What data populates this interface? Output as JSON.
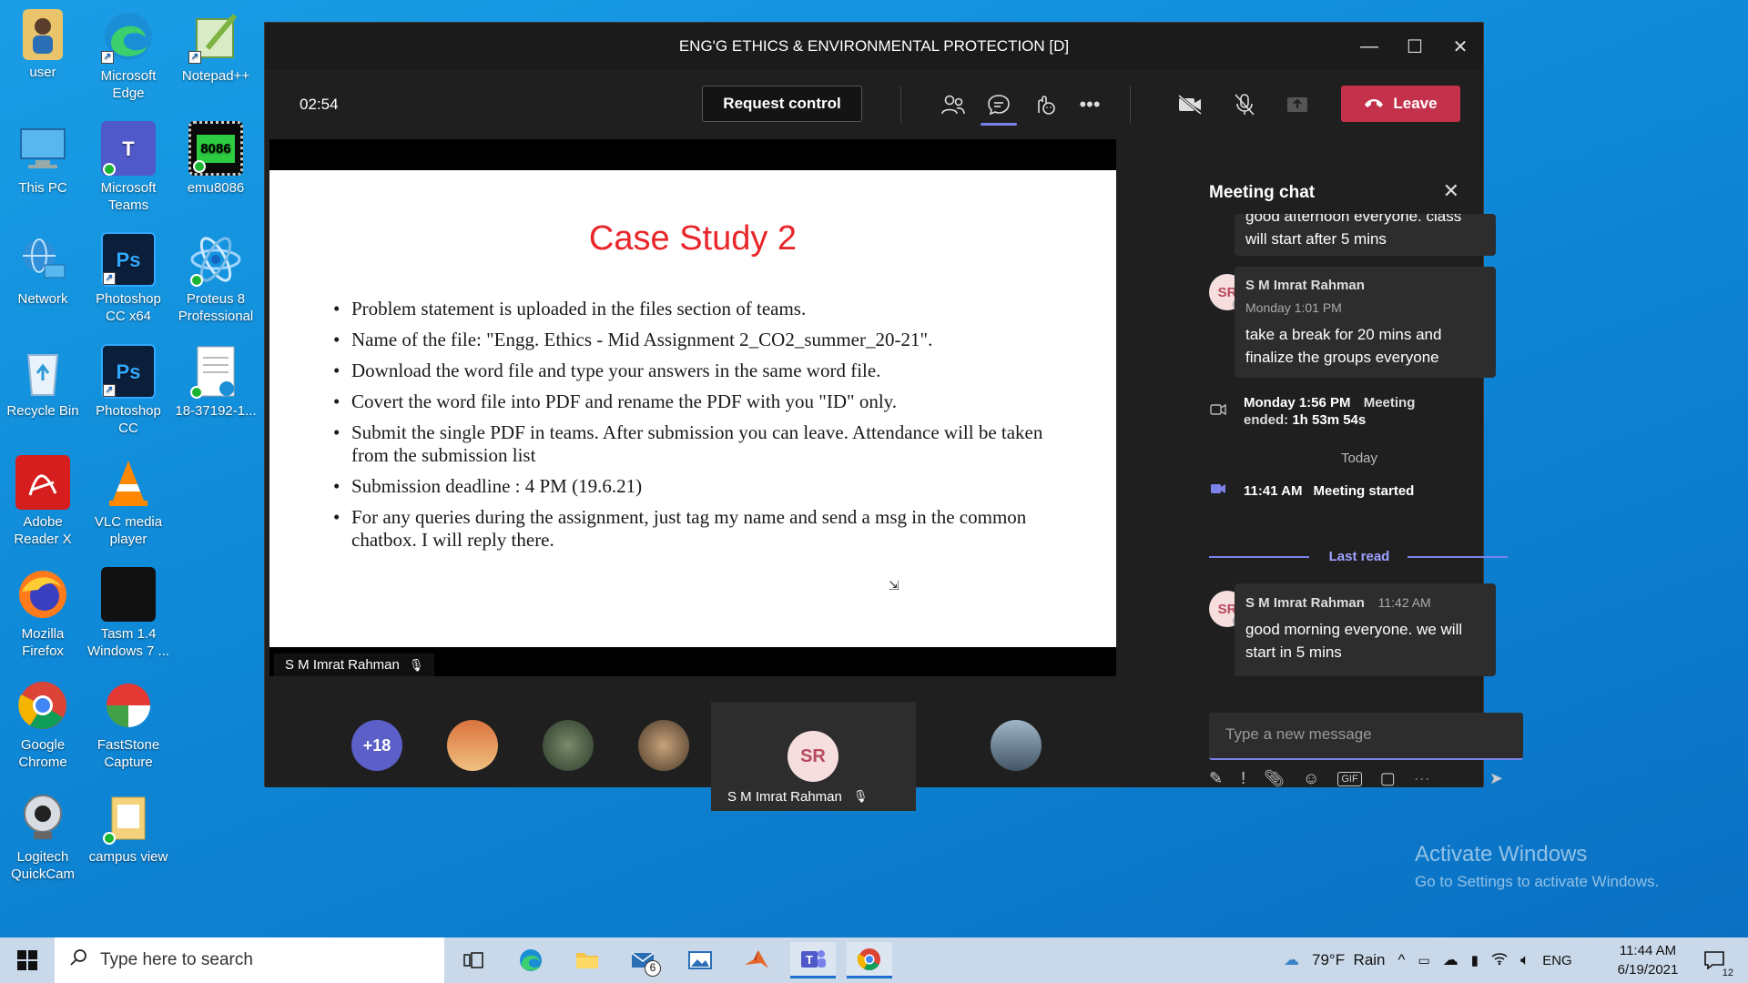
{
  "desktop": {
    "icons": [
      {
        "label": "user",
        "icon": "user-folder-icon"
      },
      {
        "label": "Microsoft Edge",
        "icon": "edge-icon"
      },
      {
        "label": "Notepad++",
        "icon": "notepadpp-icon"
      },
      {
        "label": "This PC",
        "icon": "this-pc-icon"
      },
      {
        "label": "Microsoft Teams",
        "icon": "teams-icon"
      },
      {
        "label": "emu8086",
        "icon": "emu8086-icon"
      },
      {
        "label": "Network",
        "icon": "network-icon"
      },
      {
        "label": "Photoshop CC x64",
        "icon": "photoshop-icon"
      },
      {
        "label": "Proteus 8 Professional",
        "icon": "proteus-icon"
      },
      {
        "label": "Recycle Bin",
        "icon": "recycle-bin-icon"
      },
      {
        "label": "Photoshop CC",
        "icon": "photoshop-icon"
      },
      {
        "label": "18-37192-1...",
        "icon": "document-icon"
      },
      {
        "label": "Adobe Reader X",
        "icon": "adobe-reader-icon"
      },
      {
        "label": "VLC media player",
        "icon": "vlc-icon"
      },
      {
        "label": "Mozilla Firefox",
        "icon": "firefox-icon"
      },
      {
        "label": "Tasm 1.4 Windows 7 ...",
        "icon": "tasm-icon"
      },
      {
        "label": "Google Chrome",
        "icon": "chrome-icon"
      },
      {
        "label": "FastStone Capture",
        "icon": "faststone-icon"
      },
      {
        "label": "Logitech QuickCam",
        "icon": "webcam-icon"
      },
      {
        "label": "campus view",
        "icon": "folder-icon"
      }
    ],
    "emu_badge": "8086"
  },
  "teams": {
    "window_title": "ENG'G ETHICS & ENVIRONMENTAL PROTECTION [D]",
    "timer": "02:54",
    "request_control_label": "Request control",
    "leave_label": "Leave",
    "accent_color": "#7b83eb",
    "leave_color": "#c4314b",
    "slide": {
      "title": "Case Study 2",
      "bullets": [
        "Problem statement is uploaded in the files section of teams.",
        "Name of the file: \"Engg. Ethics - Mid Assignment 2_CO2_summer_20-21\".",
        "Download the word file and type your answers in the same word file.",
        "Covert the word file into PDF and rename the PDF with you \"ID\" only.",
        "Submit the single PDF in teams. After submission you can leave. Attendance will be taken from the submission list",
        "Submission deadline : 4 PM (19.6.21)",
        "For any queries during the assignment, just tag my name and send a msg in the common chatbox. I will reply there."
      ]
    },
    "presenter_name": "S M Imrat Rahman",
    "participants": {
      "overflow_count": "+18",
      "featured_initials": "SR",
      "featured_name": "S M Imrat Rahman"
    },
    "chat": {
      "title": "Meeting chat",
      "partial_message": "good afternoon everyone. class will start after 5 mins",
      "messages": [
        {
          "initials": "SR",
          "sender": "S M Imrat Rahman",
          "time": "Monday 1:01 PM",
          "text": "take a break for 20 mins and finalize the groups everyone"
        }
      ],
      "meeting_ended": {
        "time": "Monday 1:56 PM",
        "text": "Meeting ended:",
        "duration": "1h 53m 54s"
      },
      "today_label": "Today",
      "meeting_started": {
        "time": "11:41 AM",
        "text": "Meeting started"
      },
      "last_read_label": "Last read",
      "latest": {
        "initials": "SR",
        "sender": "S M Imrat Rahman",
        "time": "11:42 AM",
        "text": "good morning everyone. we will start in 5 mins"
      },
      "compose_placeholder": "Type a new message"
    }
  },
  "watermark": {
    "line1": "Activate Windows",
    "line2": "Go to Settings to activate Windows."
  },
  "taskbar": {
    "search_placeholder": "Type here to search",
    "mail_badge": "6",
    "weather": "79°F  Rain",
    "language": "ENG",
    "time": "11:44 AM",
    "date": "6/19/2021",
    "notification_count": "12"
  }
}
